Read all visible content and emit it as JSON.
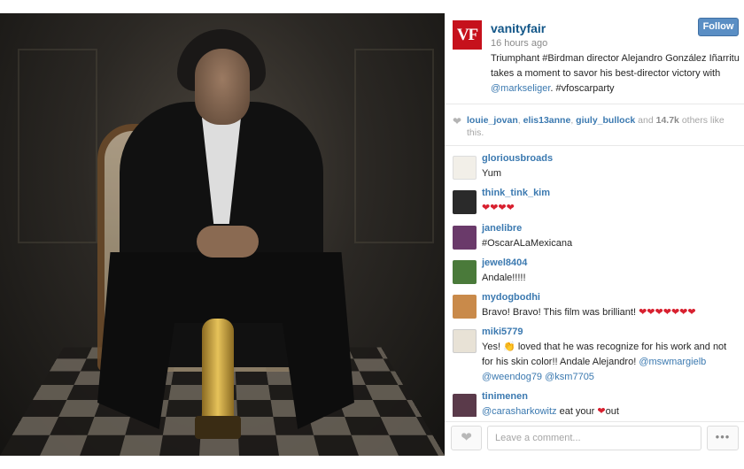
{
  "post": {
    "username": "vanityfair",
    "logo_text": "VF",
    "timestamp": "16 hours ago",
    "follow_label": "Follow",
    "caption_prefix": "Triumphant #Birdman director Alejandro González Iñarritu takes a moment to savor his best-director victory with ",
    "caption_mention": "@markseliger",
    "caption_suffix": ". #vfoscarparty"
  },
  "likes": {
    "users": [
      "louie_jovan",
      "elis13anne",
      "giuly_bullock"
    ],
    "sep1": ", ",
    "sep2": ", ",
    "and_text": " and ",
    "count": "14.7k",
    "others_text": " others like this."
  },
  "comments": [
    {
      "user": "gloriousbroads",
      "text": "Yum",
      "avatar_color": "#f2efe8"
    },
    {
      "user": "think_tink_kim",
      "text": "❤❤❤❤",
      "avatar_color": "#2a2a2a"
    },
    {
      "user": "janelibre",
      "text": "#OscarALaMexicana",
      "avatar_color": "#6a3a6a"
    },
    {
      "user": "jewel8404",
      "text": "Andale!!!!!",
      "avatar_color": "#4a7a3a"
    },
    {
      "user": "mydogbodhi",
      "text_prefix": "Bravo! Bravo! This film was brilliant! ",
      "text_hearts": "❤❤❤❤❤❤❤",
      "avatar_color": "#c98a4a"
    },
    {
      "user": "miki5779",
      "text_a": "Yes! ",
      "text_emoji": "👏",
      "text_b": " loved that he was recognize for his work and not for his skin color!! Andale Alejandro! ",
      "mention1": "@mswmargielb",
      "mention2": "@weendog79",
      "mention3": "@ksm7705",
      "avatar_color": "#e8e2d6"
    },
    {
      "user": "tinimenen",
      "mention": "@carasharkowitz",
      "text_mid": " eat your ",
      "text_heart": "❤",
      "text_end": "out",
      "avatar_color": "#5a3a4a"
    }
  ],
  "footer": {
    "comment_placeholder": "Leave a comment...",
    "more_label": "•••"
  }
}
